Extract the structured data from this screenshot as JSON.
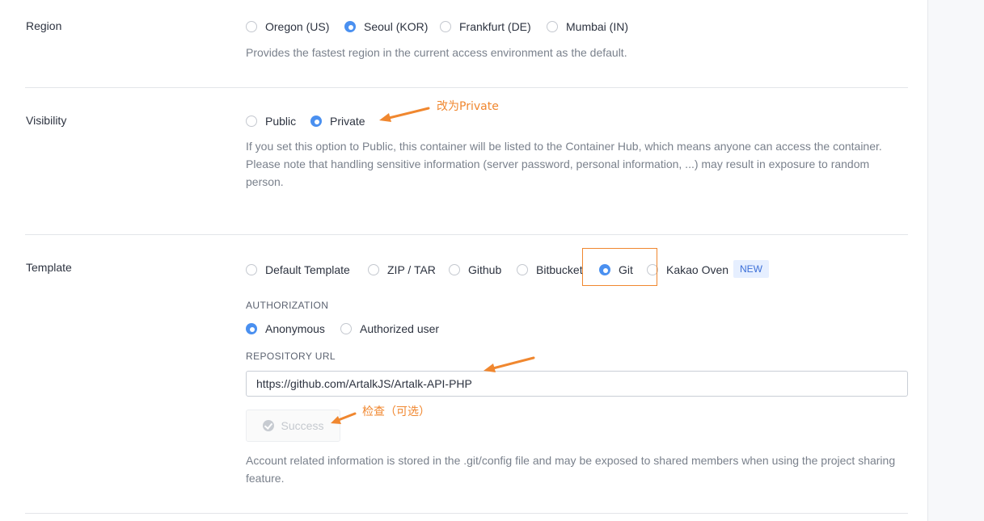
{
  "region": {
    "label": "Region",
    "options": [
      {
        "label": "Oregon (US)",
        "checked": false
      },
      {
        "label": "Seoul (KOR)",
        "checked": true
      },
      {
        "label": "Frankfurt (DE)",
        "checked": false
      },
      {
        "label": "Mumbai (IN)",
        "checked": false
      }
    ],
    "help": "Provides the fastest region in the current access environment as the default."
  },
  "visibility": {
    "label": "Visibility",
    "options": [
      {
        "label": "Public",
        "checked": false
      },
      {
        "label": "Private",
        "checked": true
      }
    ],
    "help_line1": "If you set this option to Public, this container will be listed to the Container Hub, which means anyone can access the container.",
    "help_line2": "Please note that handling sensitive information (server password, personal information, ...) may result in exposure to random person."
  },
  "template": {
    "label": "Template",
    "options": [
      {
        "label": "Default Template",
        "checked": false
      },
      {
        "label": "ZIP / TAR",
        "checked": false
      },
      {
        "label": "Github",
        "checked": false
      },
      {
        "label": "Bitbucket",
        "checked": false
      },
      {
        "label": "Git",
        "checked": true
      },
      {
        "label": "Kakao Oven",
        "checked": false
      }
    ],
    "new_badge": "NEW",
    "authorization": {
      "label": "AUTHORIZATION",
      "options": [
        {
          "label": "Anonymous",
          "checked": true
        },
        {
          "label": "Authorized user",
          "checked": false
        }
      ]
    },
    "repository_url": {
      "label": "REPOSITORY URL",
      "value": "https://github.com/ArtalkJS/Artalk-API-PHP"
    },
    "check_button": "Success",
    "help": "Account related information is stored in the .git/config file and may be exposed to shared members when using the project sharing feature."
  },
  "annotations": {
    "private_note": "改为Private",
    "check_note": "检查（可选）",
    "color": "#f0872f"
  },
  "colors": {
    "accent": "#4a90f0",
    "badge_bg": "#e6efff",
    "badge_text": "#3c6fd8"
  }
}
